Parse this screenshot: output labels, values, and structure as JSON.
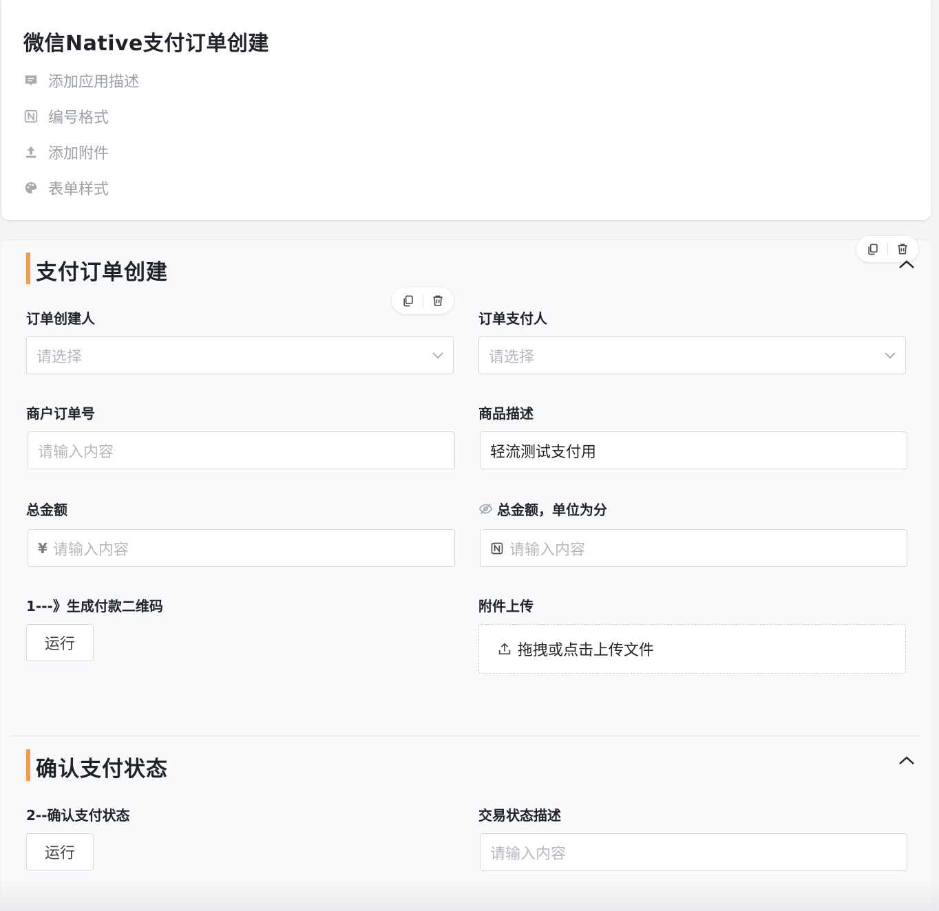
{
  "app": {
    "title": "微信Native支付订单创建",
    "meta_items": [
      {
        "label": "添加应用描述",
        "icon": "comment-icon"
      },
      {
        "label": "编号格式",
        "icon": "number-format-icon"
      },
      {
        "label": "添加附件",
        "icon": "upload-icon"
      },
      {
        "label": "表单样式",
        "icon": "palette-icon"
      }
    ]
  },
  "sections": [
    {
      "title": "支付订单创建",
      "fields": {
        "order_creator": {
          "label": "订单创建人",
          "placeholder": "请选择"
        },
        "order_payer": {
          "label": "订单支付人",
          "placeholder": "请选择"
        },
        "merchant_order_no": {
          "label": "商户订单号",
          "placeholder": "请输入内容"
        },
        "product_desc": {
          "label": "商品描述",
          "value": "轻流测试支付用"
        },
        "total_amount": {
          "label": "总金额",
          "prefix": "¥",
          "placeholder": "请输入内容"
        },
        "total_amount_fen": {
          "label": "总金额，单位为分",
          "placeholder": "请输入内容"
        },
        "gen_qr": {
          "label": "1---》生成付款二维码",
          "button": "运行"
        },
        "attachment": {
          "label": "附件上传",
          "upload_text": "拖拽或点击上传文件"
        }
      }
    },
    {
      "title": "确认支付状态",
      "fields": {
        "confirm_status": {
          "label": "2--确认支付状态",
          "button": "运行"
        },
        "trade_state_desc": {
          "label": "交易状态描述",
          "placeholder": "请输入内容"
        }
      }
    }
  ],
  "colors": {
    "accent": "#f59a45",
    "border": "#d4d7dc",
    "placeholder": "#b4b8bf",
    "muted": "#9aa0a8"
  }
}
